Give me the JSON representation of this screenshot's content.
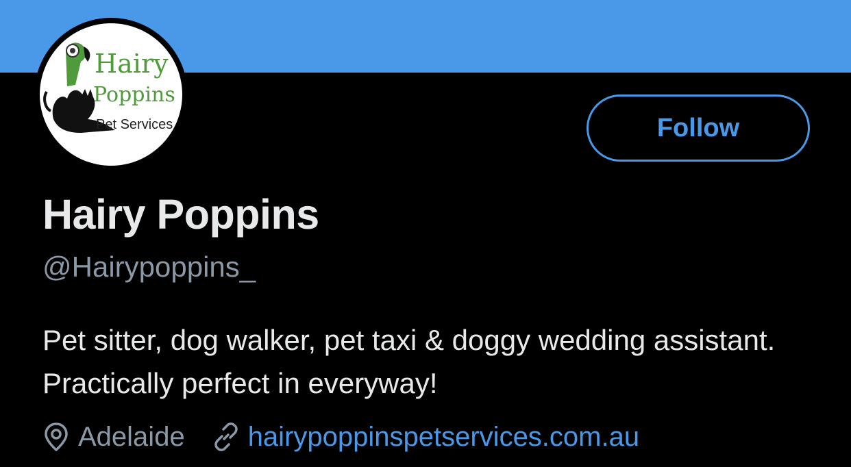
{
  "profile": {
    "display_name": "Hairy Poppins",
    "handle": "@Hairypoppins_",
    "bio": "Pet sitter, dog walker, pet taxi & doggy wedding assistant. Practically perfect in everyway!",
    "location": "Adelaide",
    "website": "hairypoppinspetservices.com.au"
  },
  "avatar_logo": {
    "line1": "Hairy",
    "line2": "Poppins",
    "line3": "Pet Services"
  },
  "actions": {
    "follow_label": "Follow"
  },
  "icons": {
    "location": "location-pin-icon",
    "website": "link-icon"
  },
  "colors": {
    "banner": "#4a99e9",
    "accent": "#4a99e9",
    "background": "#000000",
    "primary_text": "#e7e9ea",
    "secondary_text": "#8b98a5",
    "logo_green": "#4f9a3a"
  }
}
